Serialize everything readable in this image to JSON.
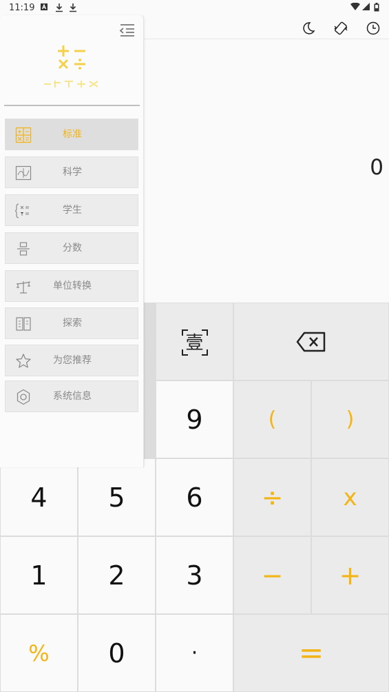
{
  "status_bar": {
    "time": "11:19"
  },
  "display": {
    "result": "0"
  },
  "drawer": {
    "menu_items": [
      {
        "label": "标准",
        "icon": "calculator-grid-icon",
        "active": true
      },
      {
        "label": "科学",
        "icon": "scientific-graph-icon",
        "active": false
      },
      {
        "label": "学生",
        "icon": "equation-icon",
        "active": false
      },
      {
        "label": "分数",
        "icon": "fraction-icon",
        "active": false
      },
      {
        "label": "单位转换",
        "icon": "scale-icon",
        "active": false
      },
      {
        "label": "探索",
        "icon": "book-icon",
        "active": false
      },
      {
        "label": "为您推荐",
        "icon": "star-icon",
        "active": false
      },
      {
        "label": "系统信息",
        "icon": "settings-icon",
        "active": false
      }
    ]
  },
  "keypad": {
    "ocr_label": "壹",
    "backspace_icon": "backspace-icon",
    "keys": {
      "nine": "9",
      "lparen": "(",
      "rparen": ")",
      "four": "4",
      "five": "5",
      "six": "6",
      "divide": "÷",
      "multiply": "x",
      "one": "1",
      "two": "2",
      "three": "3",
      "minus": "−",
      "plus": "+",
      "percent": "%",
      "zero": "0",
      "dot": "·",
      "equals": "="
    }
  },
  "colors": {
    "accent": "#f3b416",
    "key_bg": "#fafafa",
    "op_bg": "#ebebeb"
  }
}
